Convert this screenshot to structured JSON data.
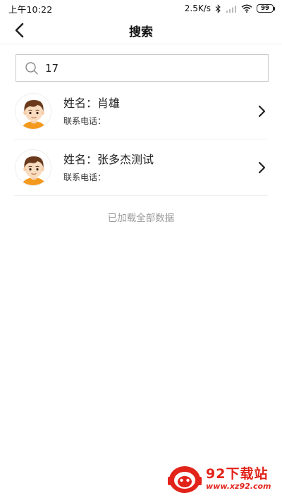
{
  "status_bar": {
    "time": "上午10:22",
    "network_speed": "2.5K/s",
    "battery": "99"
  },
  "header": {
    "title": "搜索"
  },
  "search": {
    "value": "17",
    "placeholder": ""
  },
  "results": [
    {
      "name": "姓名：肖雄",
      "phone_label": "联系电话："
    },
    {
      "name": "姓名：张多杰测试",
      "phone_label": "联系电话："
    }
  ],
  "footer": {
    "loaded_text": "已加载全部数据"
  },
  "watermark": {
    "title": "92下载站",
    "url": "www.xz92.com"
  },
  "colors": {
    "accent_orange": "#f39a1e",
    "watermark_red": "#e2231a",
    "hint_gray": "#9a9a9a"
  }
}
